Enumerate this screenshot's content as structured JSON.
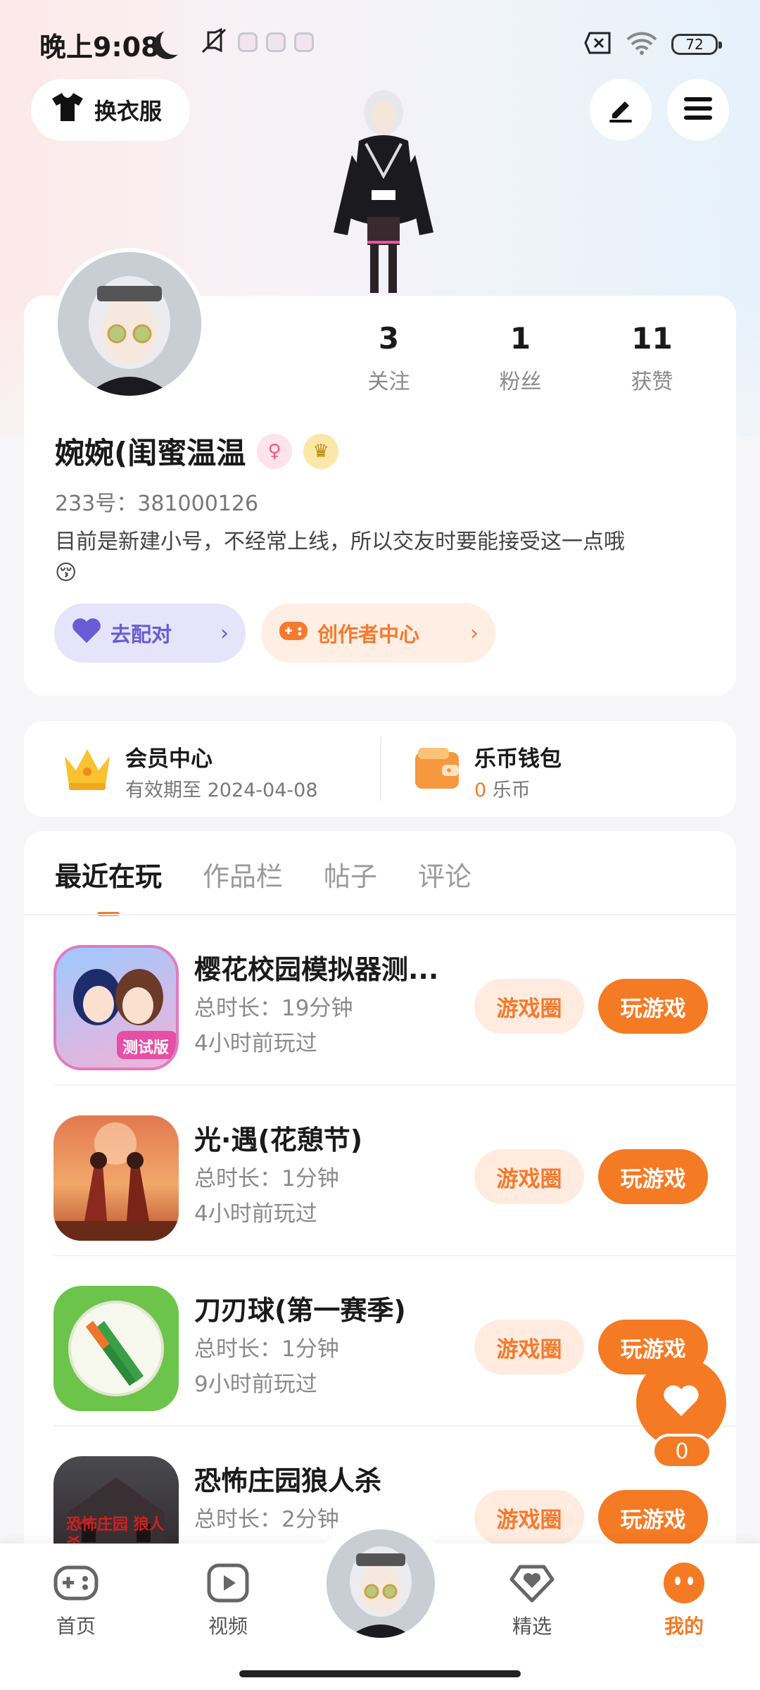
{
  "status_bar": {
    "time": "晚上9:08",
    "battery": "72"
  },
  "top": {
    "dress_label": "换衣服"
  },
  "profile": {
    "stats": [
      {
        "num": "3",
        "label": "关注"
      },
      {
        "num": "1",
        "label": "粉丝"
      },
      {
        "num": "11",
        "label": "获赞"
      }
    ],
    "nickname": "婉婉(闺蜜温温",
    "uid": "233号：381000126",
    "bio": "目前是新建小号，不经常上线，所以交友时要能接受这一点哦",
    "bio_emoji": "😚",
    "match_label": "去配对",
    "creator_label": "创作者中心"
  },
  "member": {
    "title": "会员中心",
    "sub": "有效期至 2024-04-08",
    "wallet_title": "乐币钱包",
    "wallet_amount": "0",
    "wallet_unit": "乐币"
  },
  "tabs": [
    "最近在玩",
    "作品栏",
    "帖子",
    "评论"
  ],
  "games": [
    {
      "name": "樱花校园模拟器测...",
      "duration": "总时长：19分钟",
      "last": "4小时前玩过",
      "icon_text": "测试版"
    },
    {
      "name": "光·遇(花憩节)",
      "duration": "总时长：1分钟",
      "last": "4小时前玩过"
    },
    {
      "name": "刀刃球(第一赛季)",
      "duration": "总时长：1分钟",
      "last": "9小时前玩过"
    },
    {
      "name": "恐怖庄园狼人杀",
      "duration": "总时长：2分钟",
      "last": "",
      "icon_text": "恐怖庄园 狼人杀"
    }
  ],
  "buttons": {
    "circle": "游戏圈",
    "play": "玩游戏"
  },
  "like_count": "0",
  "nav": [
    {
      "label": "首页"
    },
    {
      "label": "视频"
    },
    {
      "label": "精选"
    },
    {
      "label": "我的"
    }
  ],
  "colors": {
    "accent": "#f47a24",
    "purple": "#6a5bd6"
  }
}
